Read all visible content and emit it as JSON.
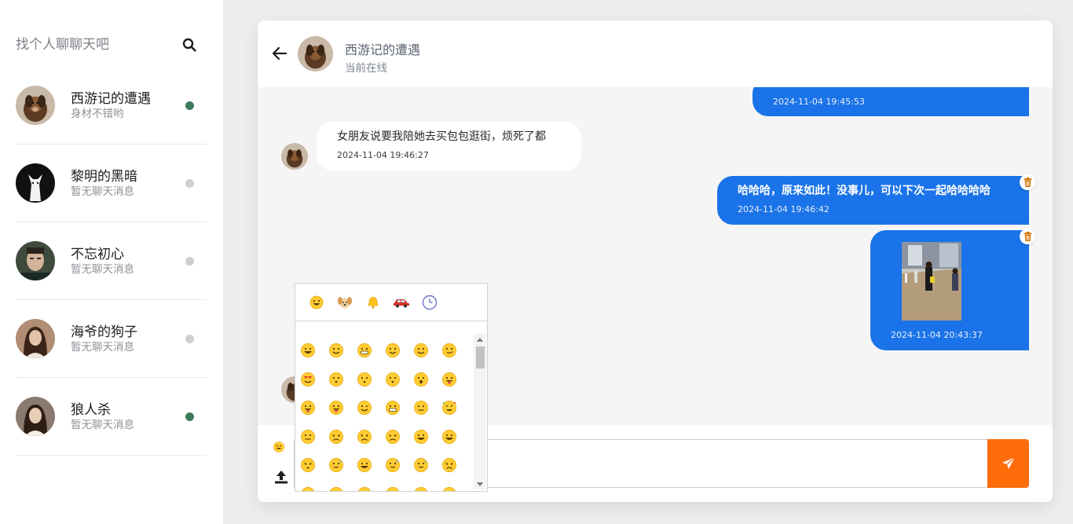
{
  "search": {
    "placeholder": "找个人聊聊天吧"
  },
  "contacts": [
    {
      "name": "西游记的遭遇",
      "preview": "身材不错哟",
      "status_color": "#3d7a5c"
    },
    {
      "name": "黎明的黑暗",
      "preview": "暂无聊天消息",
      "status_color": "#cfcfd1"
    },
    {
      "name": "不忘初心",
      "preview": "暂无聊天消息",
      "status_color": "#cfcfd1"
    },
    {
      "name": "海爷的狗子",
      "preview": "暂无聊天消息",
      "status_color": "#cfcfd1"
    },
    {
      "name": "狼人杀",
      "preview": "暂无聊天消息",
      "status_color": "#3d7a5c"
    }
  ],
  "header": {
    "title": "西游记的遭遇",
    "status": "当前在线"
  },
  "messages": [
    {
      "dir": "out",
      "text": "",
      "time": "2024-11-04 19:45:53"
    },
    {
      "dir": "in",
      "text": "女朋友说要我陪她去买包包逛街，烦死了都",
      "time": "2024-11-04 19:46:27"
    },
    {
      "dir": "out",
      "text": "哈哈哈，原来如此！没事儿，可以下次一起哈哈哈哈",
      "time": "2024-11-04 19:46:42"
    },
    {
      "dir": "out",
      "type": "image",
      "time": "2024-11-04 20:43:37"
    }
  ],
  "colors": {
    "outgoing_bubble": "#1a73e8",
    "send_button": "#ff6c0a",
    "online": "#3d7a5c",
    "offline": "#cfcfd1"
  },
  "emoji_picker": {
    "categories": [
      "smileys-icon",
      "animals-icon",
      "objects-icon",
      "travel-icon",
      "recent-icon"
    ]
  }
}
